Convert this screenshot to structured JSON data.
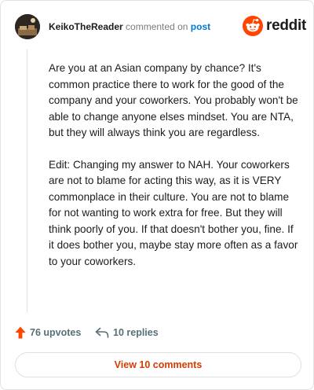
{
  "comment": {
    "author": "KeikoTheReader",
    "action_text": "commented on",
    "post_link": "post",
    "paragraphs": [
      "Are you at an Asian company by chance? It's common practice there to work for the good of the company and your coworkers. You probably won't be able to change anyone elses mindset. You are NTA, but they will always think you are regardless.",
      "Edit: Changing my answer to NAH. Your coworkers are not to blame for acting this way, as it is VERY commonplace in their culture. You are not to blame for not wanting to work extra for free. But they will think poorly of you. If that doesn't bother you, fine. If it does bother you, maybe stay more often as a favor to your coworkers."
    ],
    "upvotes": "76 upvotes",
    "replies": "10 replies"
  },
  "brand": {
    "wordmark": "reddit",
    "icon": "reddit-logo-icon",
    "color": "#ff4500"
  },
  "footer": {
    "view_comments_label": "View 10 comments"
  },
  "colors": {
    "accent": "#ff4500",
    "link": "#0079d3",
    "button_text": "#d93a00"
  }
}
